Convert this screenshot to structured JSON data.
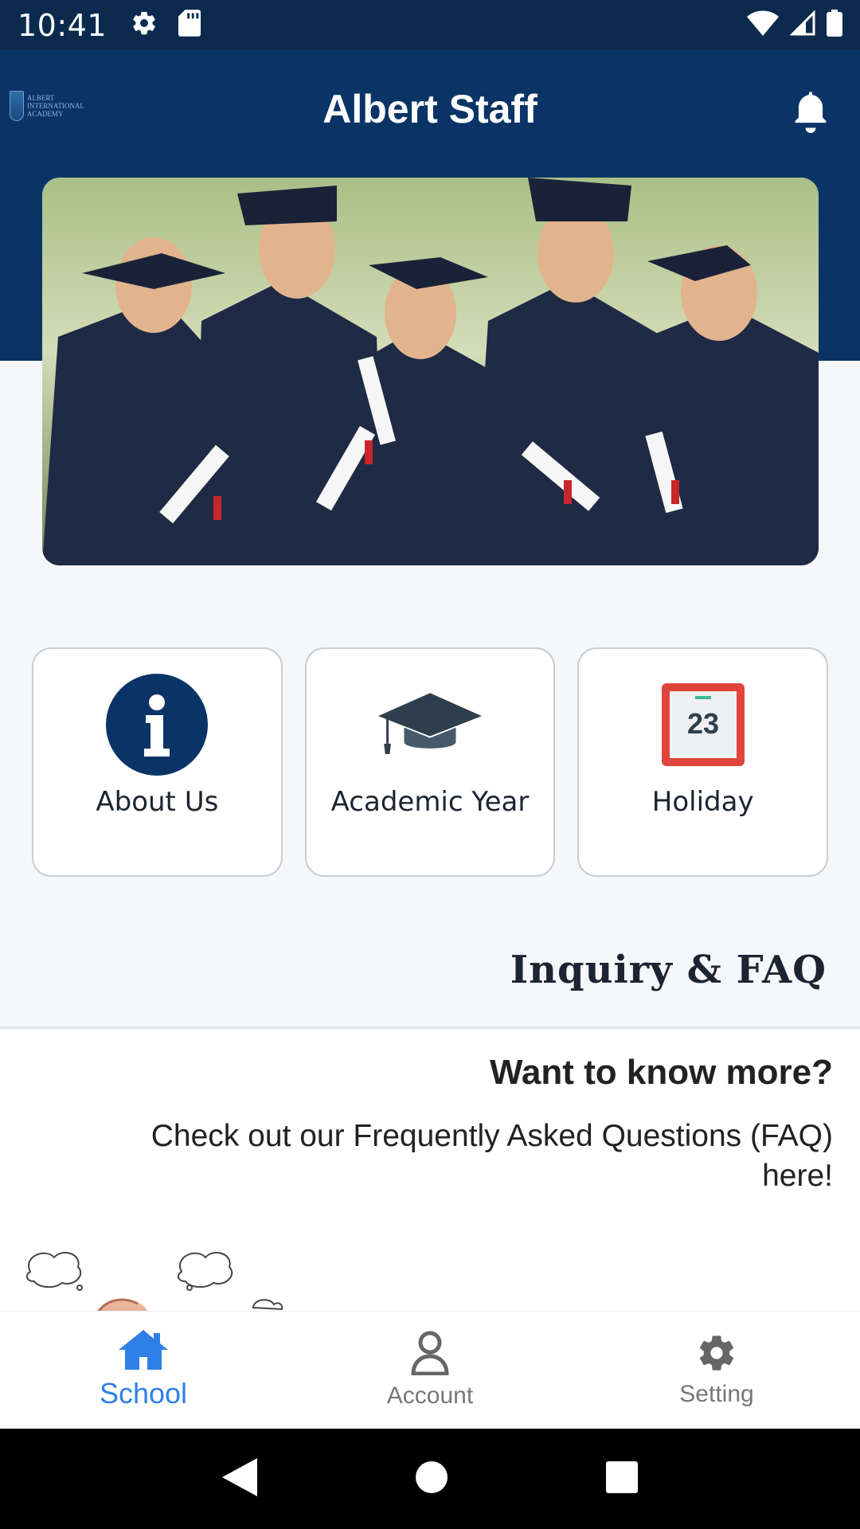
{
  "status_bar": {
    "time": "10:41",
    "icons_left": [
      "gear-icon",
      "sd-card-icon"
    ],
    "icons_right": [
      "wifi-icon",
      "signal-icon",
      "battery-icon"
    ]
  },
  "app_bar": {
    "title": "Albert Staff",
    "logo_text": "ALBERT INTERNATIONAL ACADEMY",
    "notification_icon": "bell-icon"
  },
  "banner": {
    "image": "graduates-photo"
  },
  "tiles": [
    {
      "label": "About Us",
      "icon": "info-icon"
    },
    {
      "label": "Academic Year",
      "icon": "graduation-cap-icon"
    },
    {
      "label": "Holiday",
      "icon": "calendar-icon",
      "icon_text": "23"
    }
  ],
  "faq": {
    "heading": "Inquiry & FAQ",
    "title": "Want to know more?",
    "description": "Check out our Frequently Asked Questions (FAQ) here!"
  },
  "bottom_nav": {
    "items": [
      {
        "label": "School",
        "icon": "home-icon",
        "active": true
      },
      {
        "label": "Account",
        "icon": "user-icon",
        "active": false
      },
      {
        "label": "Setting",
        "icon": "gear-icon",
        "active": false
      }
    ]
  },
  "colors": {
    "primary": "#0b3466",
    "status_bar": "#0b2a4e",
    "active_nav": "#2f80e6",
    "holiday_red": "#e0443c"
  }
}
